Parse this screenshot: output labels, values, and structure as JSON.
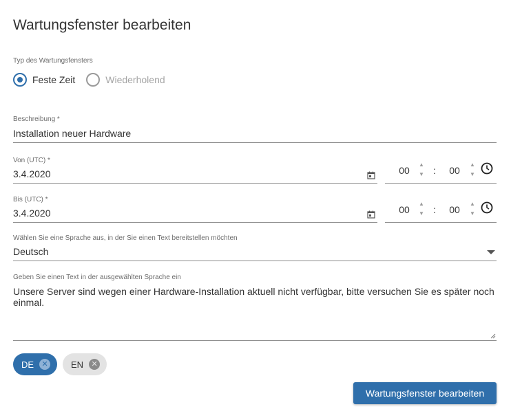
{
  "dialog": {
    "title": "Wartungsfenster bearbeiten"
  },
  "type": {
    "label": "Typ des Wartungsfensters",
    "options": [
      {
        "label": "Feste Zeit",
        "selected": true
      },
      {
        "label": "Wiederholend",
        "selected": false
      }
    ]
  },
  "description": {
    "label": "Beschreibung *",
    "value": "Installation neuer Hardware"
  },
  "from": {
    "label": "Von (UTC) *",
    "date": "3.4.2020",
    "hours": "00",
    "minutes": "00"
  },
  "to": {
    "label": "Bis (UTC) *",
    "date": "3.4.2020",
    "hours": "00",
    "minutes": "00"
  },
  "language": {
    "label": "Wählen Sie eine Sprache aus, in der Sie einen Text bereitstellen möchten",
    "value": "Deutsch"
  },
  "message": {
    "label": "Geben Sie einen Text in der ausgewählten Sprache ein",
    "value": "Unsere Server sind wegen einer Hardware-Installation aktuell nicht verfügbar, bitte versuchen Sie es später noch einmal."
  },
  "chips": [
    {
      "label": "DE",
      "active": true
    },
    {
      "label": "EN",
      "active": false
    }
  ],
  "submit": {
    "label": "Wartungsfenster bearbeiten"
  },
  "colors": {
    "accent": "#2f6fab",
    "chip_inactive": "#e3e3e3"
  },
  "icons": [
    "calendar-icon",
    "clock-icon",
    "chevron-up-icon",
    "chevron-down-icon",
    "dropdown-arrow-icon",
    "close-icon"
  ]
}
